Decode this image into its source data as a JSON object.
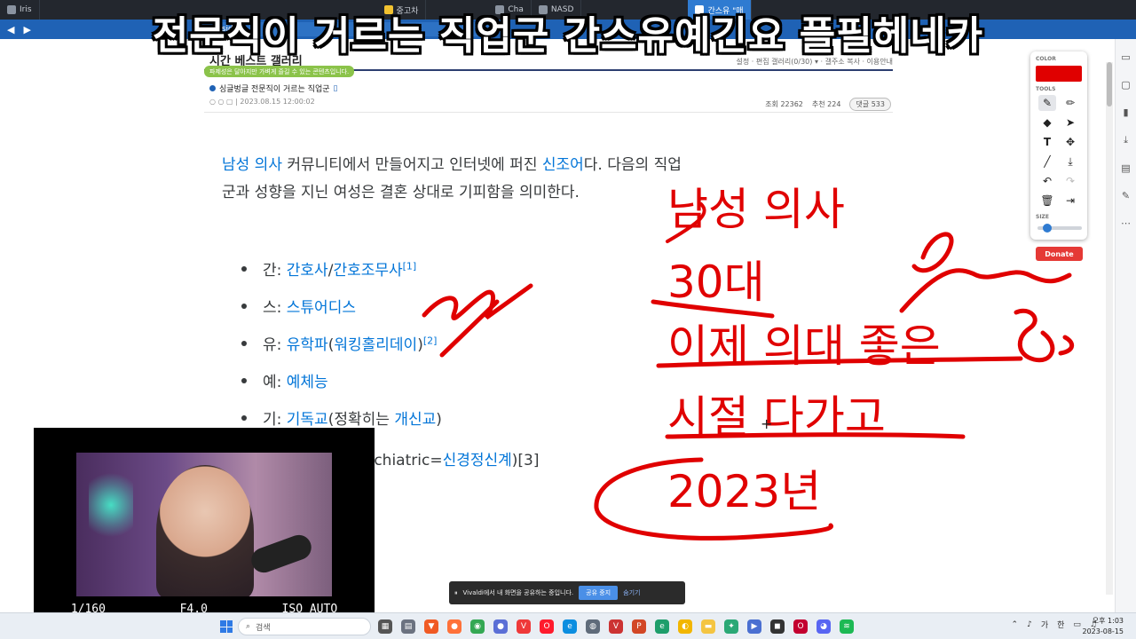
{
  "subtitle": "전문직이 거르는 직업군 간스유예긴요 플필헤네카",
  "browser": {
    "tabs": [
      {
        "label": "Iris"
      },
      {
        "label": "중고차"
      },
      {
        "label": "Cha"
      },
      {
        "label": "NASD"
      },
      {
        "label": "cinside"
      },
      {
        "label": "간스유 \"매"
      }
    ],
    "url_fragment": "dcinside"
  },
  "wiki": {
    "section_title": "시간 베스트 갤러리",
    "tools": "설정 · 편집 갤러리(0/30) ▾ · 갤주소 복사 · 이용안내",
    "notice": "파제성은 달아지만 가벼게 즐길 수 있는 콘텐츠입니다.",
    "post_title": "싱글벙글 전문직이 거르는 직업군",
    "post_meta": "○ ○ ▢ | 2023.08.15 12:00:02",
    "views": "조회 22362",
    "recommend": "추천 224",
    "comments": "댓글 533"
  },
  "article": {
    "intro_parts": [
      {
        "text": "남성 의사",
        "link": true
      },
      {
        "text": " 커뮤니티에서 만들어지고 인터넷에 퍼진 ",
        "link": false
      },
      {
        "text": "신조어",
        "link": true
      },
      {
        "text": "다. 다음의 직업군과 성향을 지닌 여성은 결혼 상대로 기피함을 의미한다.",
        "link": false
      }
    ],
    "items": [
      {
        "prefix": "간: ",
        "link1": "간호사",
        "sep": "/",
        "link2": "간호조무사",
        "sup": "[1]"
      },
      {
        "prefix": "스: ",
        "link1": "스튜어디스",
        "sep": "",
        "link2": "",
        "sup": ""
      },
      {
        "prefix": "유: ",
        "link1": "유학파",
        "sep": "(",
        "link2": "워킹홀리데이",
        "sup": "[2]"
      },
      {
        "prefix": "예: ",
        "link1": "예체능",
        "sep": "",
        "link2": "",
        "sup": ""
      },
      {
        "prefix": "기: ",
        "link1": "기독교",
        "sep": "(정확히는 ",
        "link2": "개신교",
        "sup": ")"
      }
    ],
    "partial_line": "Psychiatric=",
    "partial_link": "신경정신계",
    "partial_sup": ")[3]",
    "partial_line2": "사"
  },
  "annotation": {
    "lines": [
      "남성 의사",
      "30대",
      "이제 의대 좋은",
      "시절 다가고",
      "2023년"
    ],
    "color": "#e00000"
  },
  "palette": {
    "color_label": "COLOR",
    "tools_label": "TOOLS",
    "size_label": "SIZE",
    "donate": "Donate",
    "selected_color": "#e00000"
  },
  "webcam": {
    "shutter": "1/160",
    "aperture": "F4.0",
    "iso": "ISO AUTO"
  },
  "share": {
    "message": "Vivaldi에서 내 화면을 공유하는 중입니다.",
    "stop": "공유 중지",
    "hide": "숨기기"
  },
  "taskbar": {
    "search_placeholder": "검색",
    "ime1": "가",
    "ime2": "한",
    "time": "오후 1:03",
    "date": "2023-08-15"
  }
}
